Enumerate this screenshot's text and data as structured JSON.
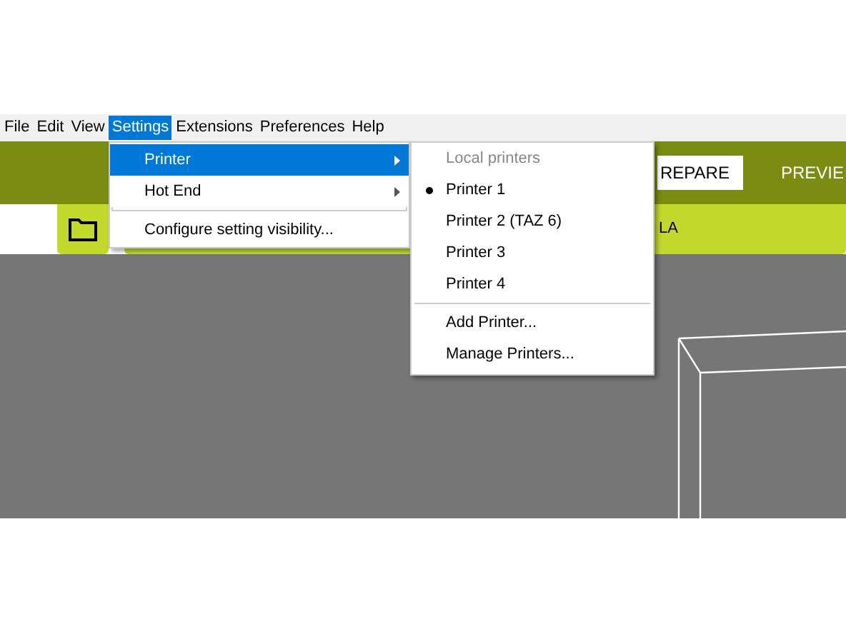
{
  "menu_bar": [
    {
      "label": "File",
      "selected": false
    },
    {
      "label": "Edit",
      "selected": false
    },
    {
      "label": "View",
      "selected": false
    },
    {
      "label": "Settings",
      "selected": true
    },
    {
      "label": "Extensions",
      "selected": false
    },
    {
      "label": "Preferences",
      "selected": false
    },
    {
      "label": "Help",
      "selected": false
    }
  ],
  "header": {
    "tabs": [
      {
        "label": "REPARE",
        "selected": true
      },
      {
        "label": "PREVIE",
        "selected": false
      }
    ]
  },
  "toolbar": {
    "material_label": "LA"
  },
  "settings_menu": [
    {
      "label": "Printer",
      "submenu": true,
      "selected": true,
      "separator_after": false
    },
    {
      "label": "Hot End",
      "submenu": true,
      "selected": false,
      "separator_after": true
    },
    {
      "label": "Configure setting visibility...",
      "submenu": false,
      "selected": false,
      "separator_after": false
    }
  ],
  "printer_menu": [
    {
      "kind": "heading",
      "label": "Local printers"
    },
    {
      "kind": "printer",
      "label": "Printer 1",
      "selected": true
    },
    {
      "kind": "printer",
      "label": "Printer 2 (TAZ 6)",
      "selected": false
    },
    {
      "kind": "printer",
      "label": "Printer 3",
      "selected": false
    },
    {
      "kind": "printer",
      "label": "Printer 4",
      "selected": false
    },
    {
      "kind": "separator"
    },
    {
      "kind": "action",
      "label": "Add Printer..."
    },
    {
      "kind": "action",
      "label": "Manage Printers..."
    }
  ]
}
